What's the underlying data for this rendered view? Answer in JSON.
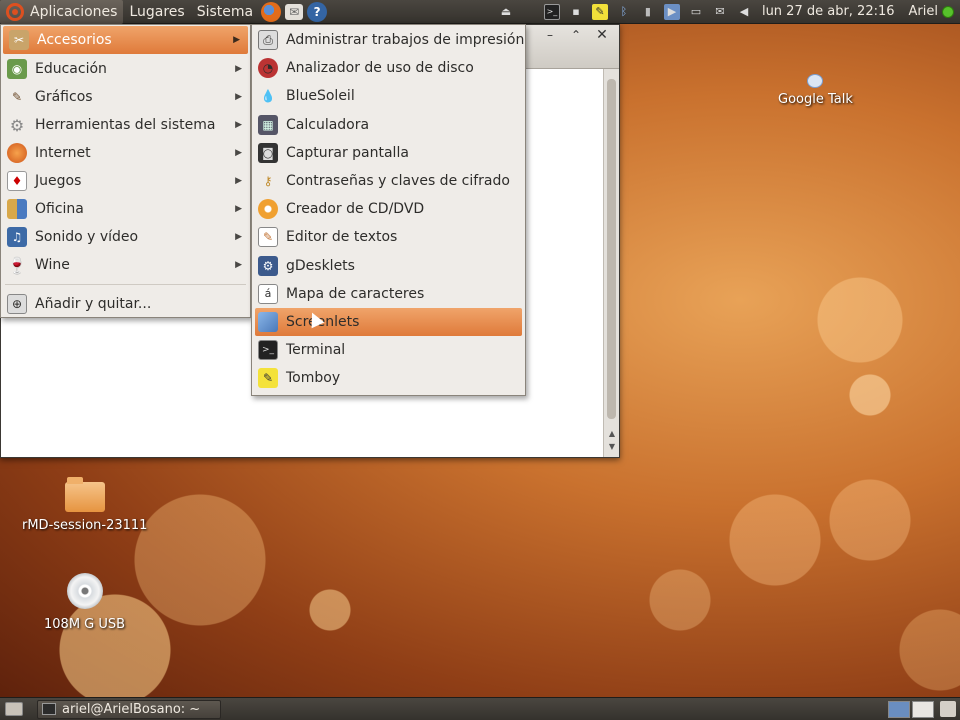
{
  "top_panel": {
    "menus": [
      "Aplicaciones",
      "Lugares",
      "Sistema"
    ],
    "launchers": [
      "firefox-icon",
      "mail-icon",
      "help-icon"
    ],
    "clock": "lun 27 de abr, 22:16",
    "user": "Ariel",
    "tray_icons": [
      "network-icon",
      "terminal-icon",
      "display-icon",
      "notes-icon",
      "bluetooth-icon",
      "signal-icon",
      "media-icon",
      "battery-icon",
      "mail-notify-icon",
      "volume-icon"
    ]
  },
  "main_menu": {
    "items": [
      {
        "label": "Accesorios",
        "icon": "accessories-icon",
        "active": true
      },
      {
        "label": "Educación",
        "icon": "education-icon"
      },
      {
        "label": "Gráficos",
        "icon": "graphics-icon"
      },
      {
        "label": "Herramientas del sistema",
        "icon": "system-tools-icon"
      },
      {
        "label": "Internet",
        "icon": "internet-icon"
      },
      {
        "label": "Juegos",
        "icon": "games-icon"
      },
      {
        "label": "Oficina",
        "icon": "office-icon"
      },
      {
        "label": "Sonido y vídeo",
        "icon": "sound-video-icon"
      },
      {
        "label": "Wine",
        "icon": "wine-icon"
      }
    ],
    "add_remove": "Añadir y quitar..."
  },
  "sub_menu": {
    "items": [
      {
        "label": "Administrar trabajos de impresión",
        "icon": "printer-icon"
      },
      {
        "label": "Analizador de uso de disco",
        "icon": "disk-usage-icon"
      },
      {
        "label": "BlueSoleil",
        "icon": "bluesoleil-icon"
      },
      {
        "label": "Calculadora",
        "icon": "calculator-icon"
      },
      {
        "label": "Capturar pantalla",
        "icon": "camera-icon"
      },
      {
        "label": "Contraseñas y claves de cifrado",
        "icon": "keys-icon"
      },
      {
        "label": "Creador de CD/DVD",
        "icon": "cd-burner-icon"
      },
      {
        "label": "Editor de textos",
        "icon": "text-editor-icon"
      },
      {
        "label": "gDesklets",
        "icon": "gdesklets-icon"
      },
      {
        "label": "Mapa de caracteres",
        "icon": "character-map-icon"
      },
      {
        "label": "Screenlets",
        "icon": "screenlets-icon",
        "active": true
      },
      {
        "label": "Terminal",
        "icon": "terminal-icon"
      },
      {
        "label": "Tomboy",
        "icon": "tomboy-icon"
      }
    ]
  },
  "desktop": {
    "icons": [
      {
        "label": "rMD-session-23111",
        "icon": "folder-icon"
      },
      {
        "label": "108M G USB",
        "icon": "cd-drive-icon"
      },
      {
        "label": "Google Talk",
        "icon": "google-talk-icon"
      }
    ]
  },
  "bottom_panel": {
    "task": "ariel@ArielBosano: ~"
  },
  "colors": {
    "menu_highlight": "#e8894a",
    "panel": "#3e3a35",
    "menu_bg": "#efece8"
  }
}
